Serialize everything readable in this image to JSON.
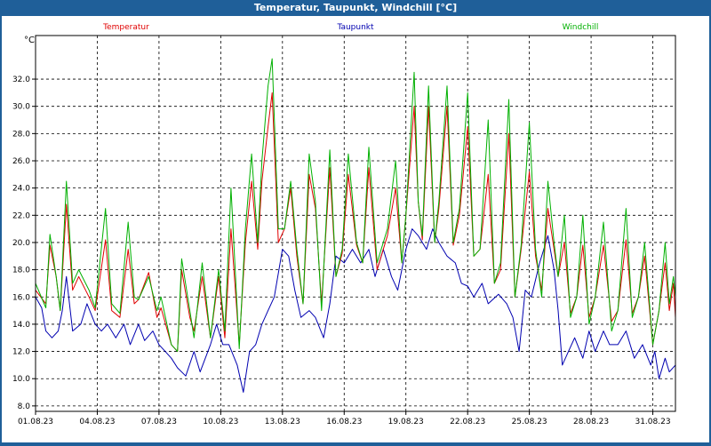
{
  "window": {
    "title": "Temperatur, Taupunkt, Windchill [°C]"
  },
  "chart_data": {
    "type": "line",
    "ylabel": "°C",
    "ylim": [
      7.6,
      35.2
    ],
    "yticks": [
      "8.0",
      "10.0",
      "12.0",
      "14.0",
      "16.0",
      "18.0",
      "20.0",
      "22.0",
      "24.0",
      "26.0",
      "28.0",
      "30.0",
      "32.0"
    ],
    "xlim": [
      0,
      31.1
    ],
    "xticks": [
      {
        "x": 0,
        "label": "01.08.23"
      },
      {
        "x": 3,
        "label": "04.08.23"
      },
      {
        "x": 6,
        "label": "07.08.23"
      },
      {
        "x": 9,
        "label": "10.08.23"
      },
      {
        "x": 12,
        "label": "13.08.23"
      },
      {
        "x": 15,
        "label": "16.08.23"
      },
      {
        "x": 18,
        "label": "19.08.23"
      },
      {
        "x": 21,
        "label": "22.08.23"
      },
      {
        "x": 24,
        "label": "25.08.23"
      },
      {
        "x": 27,
        "label": "28.08.23"
      },
      {
        "x": 30,
        "label": "31.08.23"
      }
    ],
    "grid": true,
    "series": [
      {
        "name": "Temperatur",
        "color": "#e00000",
        "points": [
          [
            0,
            16.5
          ],
          [
            0.5,
            15.5
          ],
          [
            0.7,
            19.8
          ],
          [
            1,
            17.5
          ],
          [
            1.2,
            15
          ],
          [
            1.5,
            22.8
          ],
          [
            1.8,
            16.5
          ],
          [
            2.1,
            17.5
          ],
          [
            2.6,
            16
          ],
          [
            2.9,
            15
          ],
          [
            3.4,
            20.2
          ],
          [
            3.7,
            15
          ],
          [
            4.1,
            14.5
          ],
          [
            4.5,
            19.5
          ],
          [
            4.8,
            15.5
          ],
          [
            5,
            15.8
          ],
          [
            5.5,
            17.8
          ],
          [
            5.9,
            14.5
          ],
          [
            6.1,
            15.2
          ],
          [
            6.6,
            12.5
          ],
          [
            6.9,
            12
          ],
          [
            7.1,
            18
          ],
          [
            7.5,
            14.5
          ],
          [
            7.7,
            13.5
          ],
          [
            8.1,
            17.5
          ],
          [
            8.5,
            13
          ],
          [
            8.9,
            17.5
          ],
          [
            9.2,
            13
          ],
          [
            9.5,
            21
          ],
          [
            9.9,
            12.5
          ],
          [
            10.2,
            20
          ],
          [
            10.5,
            24.5
          ],
          [
            10.8,
            19.5
          ],
          [
            11,
            24.5
          ],
          [
            11.3,
            28.5
          ],
          [
            11.5,
            31
          ],
          [
            11.8,
            20
          ],
          [
            12.1,
            21
          ],
          [
            12.4,
            24
          ],
          [
            12.7,
            19
          ],
          [
            13,
            15.5
          ],
          [
            13.3,
            25
          ],
          [
            13.6,
            22.5
          ],
          [
            13.9,
            15.5
          ],
          [
            14.3,
            25.5
          ],
          [
            14.6,
            17.5
          ],
          [
            14.9,
            19.2
          ],
          [
            15.2,
            25
          ],
          [
            15.6,
            19.8
          ],
          [
            15.9,
            18.5
          ],
          [
            16.2,
            25.5
          ],
          [
            16.6,
            18
          ],
          [
            17.1,
            20.5
          ],
          [
            17.5,
            24
          ],
          [
            17.8,
            18.5
          ],
          [
            18,
            22
          ],
          [
            18.4,
            30
          ],
          [
            18.6,
            23
          ],
          [
            18.8,
            20.2
          ],
          [
            19.1,
            30
          ],
          [
            19.4,
            20
          ],
          [
            19.6,
            22.5
          ],
          [
            20,
            30
          ],
          [
            20.3,
            19.8
          ],
          [
            20.6,
            22
          ],
          [
            21,
            28.5
          ],
          [
            21.3,
            19
          ],
          [
            21.6,
            19.5
          ],
          [
            22,
            25
          ],
          [
            22.3,
            17
          ],
          [
            22.6,
            18
          ],
          [
            23,
            28
          ],
          [
            23.3,
            16
          ],
          [
            23.6,
            19.5
          ],
          [
            24,
            25.2
          ],
          [
            24.3,
            19
          ],
          [
            24.6,
            16.5
          ],
          [
            24.9,
            22.5
          ],
          [
            25.2,
            19.5
          ],
          [
            25.4,
            17.5
          ],
          [
            25.7,
            20
          ],
          [
            26,
            14.8
          ],
          [
            26.3,
            16
          ],
          [
            26.6,
            19.8
          ],
          [
            26.9,
            14.5
          ],
          [
            27.2,
            16
          ],
          [
            27.6,
            19.8
          ],
          [
            28,
            14.2
          ],
          [
            28.3,
            15
          ],
          [
            28.7,
            20.2
          ],
          [
            29,
            14.8
          ],
          [
            29.3,
            16
          ],
          [
            29.6,
            19
          ],
          [
            30,
            12.5
          ],
          [
            30.3,
            15
          ],
          [
            30.6,
            18.5
          ],
          [
            30.8,
            15
          ],
          [
            31,
            17
          ],
          [
            31.1,
            14.5
          ]
        ]
      },
      {
        "name": "Taupunkt",
        "color": "#0000b0",
        "points": [
          [
            0,
            16
          ],
          [
            0.3,
            15.2
          ],
          [
            0.5,
            13.5
          ],
          [
            0.8,
            13
          ],
          [
            1.1,
            13.5
          ],
          [
            1.3,
            15
          ],
          [
            1.5,
            17.5
          ],
          [
            1.8,
            13.5
          ],
          [
            2.2,
            14
          ],
          [
            2.5,
            15.5
          ],
          [
            2.9,
            14
          ],
          [
            3.2,
            13.5
          ],
          [
            3.5,
            14
          ],
          [
            3.9,
            13
          ],
          [
            4.3,
            14
          ],
          [
            4.6,
            12.5
          ],
          [
            5,
            14
          ],
          [
            5.3,
            12.8
          ],
          [
            5.7,
            13.5
          ],
          [
            6,
            12.5
          ],
          [
            6.3,
            12
          ],
          [
            6.6,
            11.5
          ],
          [
            6.9,
            10.8
          ],
          [
            7.3,
            10.2
          ],
          [
            7.7,
            12
          ],
          [
            8,
            10.5
          ],
          [
            8.5,
            12.5
          ],
          [
            8.8,
            14
          ],
          [
            9.1,
            12.5
          ],
          [
            9.4,
            12.5
          ],
          [
            9.8,
            11
          ],
          [
            10.1,
            9
          ],
          [
            10.4,
            12
          ],
          [
            10.7,
            12.5
          ],
          [
            11,
            14
          ],
          [
            11.3,
            15
          ],
          [
            11.6,
            16
          ],
          [
            12,
            19.5
          ],
          [
            12.3,
            19
          ],
          [
            12.6,
            16.5
          ],
          [
            12.9,
            14.5
          ],
          [
            13.3,
            15
          ],
          [
            13.6,
            14.5
          ],
          [
            14,
            13
          ],
          [
            14.3,
            15.5
          ],
          [
            14.6,
            19
          ],
          [
            15,
            18.5
          ],
          [
            15.4,
            19.5
          ],
          [
            15.8,
            18.5
          ],
          [
            16.2,
            19.5
          ],
          [
            16.5,
            17.5
          ],
          [
            16.9,
            19.5
          ],
          [
            17.3,
            17.5
          ],
          [
            17.6,
            16.5
          ],
          [
            18,
            19.5
          ],
          [
            18.3,
            21
          ],
          [
            18.6,
            20.5
          ],
          [
            19,
            19.5
          ],
          [
            19.3,
            21
          ],
          [
            19.6,
            20
          ],
          [
            20,
            19
          ],
          [
            20.4,
            18.5
          ],
          [
            20.7,
            17
          ],
          [
            21,
            16.8
          ],
          [
            21.3,
            16
          ],
          [
            21.7,
            17
          ],
          [
            22,
            15.5
          ],
          [
            22.5,
            16.2
          ],
          [
            22.9,
            15.5
          ],
          [
            23.2,
            14.5
          ],
          [
            23.5,
            12
          ],
          [
            23.8,
            16.5
          ],
          [
            24.1,
            16
          ],
          [
            24.5,
            18.5
          ],
          [
            24.9,
            20.5
          ],
          [
            25.2,
            18
          ],
          [
            25.4,
            15
          ],
          [
            25.6,
            11
          ],
          [
            25.9,
            12
          ],
          [
            26.2,
            13
          ],
          [
            26.6,
            11.5
          ],
          [
            26.9,
            13.5
          ],
          [
            27.2,
            12
          ],
          [
            27.6,
            13.5
          ],
          [
            27.9,
            12.5
          ],
          [
            28.3,
            12.5
          ],
          [
            28.7,
            13.5
          ],
          [
            29.1,
            11.5
          ],
          [
            29.5,
            12.5
          ],
          [
            29.9,
            11
          ],
          [
            30.1,
            12
          ],
          [
            30.3,
            10
          ],
          [
            30.6,
            11.5
          ],
          [
            30.8,
            10.5
          ],
          [
            31.1,
            11
          ]
        ]
      },
      {
        "name": "Windchill",
        "color": "#00b000",
        "points": [
          [
            0,
            17
          ],
          [
            0.5,
            15.2
          ],
          [
            0.7,
            20.6
          ],
          [
            1,
            17.5
          ],
          [
            1.2,
            15
          ],
          [
            1.5,
            24.5
          ],
          [
            1.8,
            17
          ],
          [
            2.1,
            18
          ],
          [
            2.6,
            16.5
          ],
          [
            2.9,
            15.2
          ],
          [
            3.4,
            22.5
          ],
          [
            3.7,
            15.5
          ],
          [
            4.1,
            14.8
          ],
          [
            4.5,
            21.5
          ],
          [
            4.8,
            16
          ],
          [
            5,
            15.8
          ],
          [
            5.5,
            17.5
          ],
          [
            5.9,
            15
          ],
          [
            6.1,
            16
          ],
          [
            6.6,
            12.5
          ],
          [
            6.9,
            12
          ],
          [
            7.1,
            18.8
          ],
          [
            7.5,
            15
          ],
          [
            7.7,
            13
          ],
          [
            8.1,
            18.5
          ],
          [
            8.5,
            13
          ],
          [
            8.9,
            18
          ],
          [
            9.2,
            13.5
          ],
          [
            9.5,
            24
          ],
          [
            9.9,
            12.2
          ],
          [
            10.2,
            21
          ],
          [
            10.5,
            26.5
          ],
          [
            10.8,
            20
          ],
          [
            11,
            26
          ],
          [
            11.3,
            31.5
          ],
          [
            11.5,
            33.5
          ],
          [
            11.8,
            21
          ],
          [
            12.1,
            21
          ],
          [
            12.4,
            24.5
          ],
          [
            12.7,
            19.5
          ],
          [
            13,
            15.5
          ],
          [
            13.3,
            26.5
          ],
          [
            13.6,
            23
          ],
          [
            13.9,
            15
          ],
          [
            14.3,
            26.8
          ],
          [
            14.6,
            17.5
          ],
          [
            14.9,
            19.5
          ],
          [
            15.2,
            26.5
          ],
          [
            15.6,
            20
          ],
          [
            15.9,
            18.5
          ],
          [
            16.2,
            27
          ],
          [
            16.6,
            18.5
          ],
          [
            17.1,
            21
          ],
          [
            17.5,
            26
          ],
          [
            17.8,
            18.5
          ],
          [
            18,
            22
          ],
          [
            18.4,
            32.5
          ],
          [
            18.6,
            23
          ],
          [
            18.8,
            20.5
          ],
          [
            19.1,
            31.5
          ],
          [
            19.4,
            20
          ],
          [
            19.6,
            23
          ],
          [
            20,
            31.5
          ],
          [
            20.3,
            20
          ],
          [
            20.6,
            22.5
          ],
          [
            21,
            31
          ],
          [
            21.3,
            19
          ],
          [
            21.6,
            19.5
          ],
          [
            22,
            29
          ],
          [
            22.3,
            17
          ],
          [
            22.6,
            18.5
          ],
          [
            23,
            30.5
          ],
          [
            23.3,
            16
          ],
          [
            23.6,
            19.8
          ],
          [
            24,
            28.8
          ],
          [
            24.3,
            19.5
          ],
          [
            24.6,
            16
          ],
          [
            24.9,
            24.5
          ],
          [
            25.2,
            20
          ],
          [
            25.4,
            17.5
          ],
          [
            25.7,
            22
          ],
          [
            26,
            14.5
          ],
          [
            26.3,
            16
          ],
          [
            26.6,
            22
          ],
          [
            26.9,
            14
          ],
          [
            27.2,
            16
          ],
          [
            27.6,
            21.5
          ],
          [
            28,
            13.5
          ],
          [
            28.3,
            15
          ],
          [
            28.7,
            22.5
          ],
          [
            29,
            14.5
          ],
          [
            29.3,
            16
          ],
          [
            29.6,
            20
          ],
          [
            30,
            12.5
          ],
          [
            30.3,
            15
          ],
          [
            30.6,
            20
          ],
          [
            30.8,
            15.5
          ],
          [
            31,
            17.5
          ],
          [
            31.1,
            16
          ]
        ]
      }
    ]
  }
}
